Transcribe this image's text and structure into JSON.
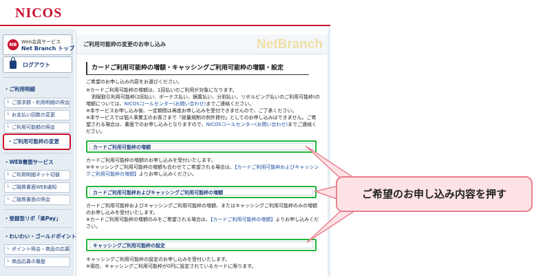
{
  "header": {
    "logo": "NICOS"
  },
  "sidebar": {
    "netbranch_sub": "Web会員サービス",
    "netbranch_main": "Net Branch トップ",
    "logout": "ログアウト",
    "cat_usage": "・ご利用明細",
    "items_usage": [
      "ご請求額・利用明細の照会",
      "お支払い回数の変更",
      "ご利用可能額の照会"
    ],
    "active": "・ご利用可能枠の変更",
    "cat_web": "・WEB書面サービス",
    "items_web": [
      "ご利用明細ネット切替",
      "ご融資書面WEB通知",
      "ご融資書面の照会"
    ],
    "cat_ribo": "・登録型リボ「楽Pay」",
    "cat_point": "・わいわい・ゴールドポイント",
    "items_point": [
      "ポイント照会・商品の応募",
      "商品応募の履歴"
    ]
  },
  "main": {
    "page_title": "ご利用可能枠の変更のお申し込み",
    "watermark": "NetBranch",
    "section_title": "カードご利用可能枠の増額・キャッシングご利用可能枠の増額・設定",
    "intro": "ご希望のお申し込み内容をお選びください。",
    "note1": "※カードご利用可能枠の増額は、1回払いのご利用が対象になります。",
    "note1b": "割賦取引利用可能枠(2回払い、ボーナス払い、据置払い、分割払い、リボルビング払いのご利用可能枠)の増額については、",
    "note1_link": "NICOSコールセンター(お問い合わせ)",
    "note1_tail": "までご連絡ください。",
    "note2": "※本サービスお申し込み後、一定期間は再度お申し込みを受付できませんので、ご了承ください。",
    "note3": "※本サービスでは個人事業主のお客さまで「総量規制の例外貸付」としてのお申し込みはできません。ご希望される場合は、書面でのお申し込みとなりますので、",
    "note3_link": "NICOSコールセンター(お問い合わせ)",
    "note3_tail": "までご連絡ください。",
    "option1_label": "カードご利用可能枠の増額",
    "option1_desc1": "カードご利用可能枠の増額のお申し込みを受付いたします。",
    "option1_desc2": "※キャッシングご利用可能枠の増額も合わせてご希望される場合は、",
    "option1_link": "【カードご利用可能枠およびキャッシングご利用可能枠の増額】",
    "option1_tail": "よりお申し込みください。",
    "option2_label": "カードご利用可能枠およびキャッシングご利用可能枠の増額",
    "option2_desc1": "カードご利用可能枠およびキャッシングご利用可能枠の増額、またはキャッシングご利用可能枠のみの増額のお申し込みを受付いたします。",
    "option2_desc2": "※カードご利用可能枠の増額のみをご希望される場合は、",
    "option2_link": "【カードご利用可能枠の増額】",
    "option2_tail": "よりお申し込みください。",
    "option3_label": "キャッシングご利用可能枠の設定",
    "option3_desc1": "キャッシングご利用可能枠の設定のお申し込みを受付いたします。",
    "option3_desc2": "※現在、キャッシングご利用可能枠が0円に設定されているカードに限ります。"
  },
  "callout": {
    "text": "ご希望のお申し込み内容を押す"
  },
  "colors": {
    "brand": "#c8102e",
    "highlight": "#1fb63a",
    "callout_bg": "#fde3e6",
    "callout_border": "#e8808e"
  }
}
